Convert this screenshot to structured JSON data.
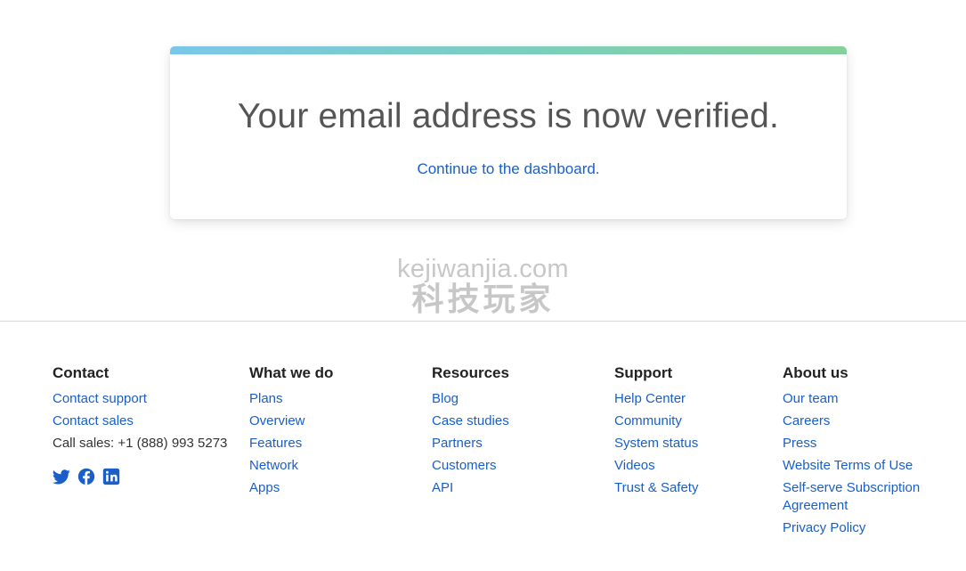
{
  "card": {
    "title": "Your email address is now verified.",
    "link_label": "Continue to the dashboard."
  },
  "watermark": {
    "url": "kejiwanjia.com",
    "chinese": "科技玩家"
  },
  "footer": {
    "contact": {
      "heading": "Contact",
      "links": [
        "Contact support",
        "Contact sales"
      ],
      "phone_text": "Call sales: +1 (888) 993 5273",
      "social": [
        "twitter-icon",
        "facebook-icon",
        "linkedin-icon"
      ]
    },
    "what_we_do": {
      "heading": "What we do",
      "links": [
        "Plans",
        "Overview",
        "Features",
        "Network",
        "Apps"
      ]
    },
    "resources": {
      "heading": "Resources",
      "links": [
        "Blog",
        "Case studies",
        "Partners",
        "Customers",
        "API"
      ]
    },
    "support": {
      "heading": "Support",
      "links": [
        "Help Center",
        "Community",
        "System status",
        "Videos",
        "Trust & Safety"
      ]
    },
    "about": {
      "heading": "About us",
      "links": [
        "Our team",
        "Careers",
        "Press",
        "Website Terms of Use",
        "Self-serve Subscription Agreement",
        "Privacy Policy"
      ]
    }
  },
  "colors": {
    "link": "#1a5fc7",
    "title": "#555555",
    "bar_start": "#79c7ea",
    "bar_end": "#86d09c"
  }
}
